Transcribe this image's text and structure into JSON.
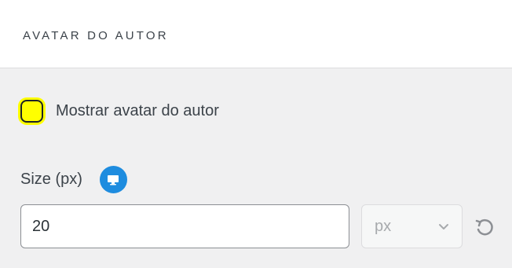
{
  "section": {
    "title": "AVATAR DO AUTOR"
  },
  "checkbox": {
    "label": "Mostrar avatar do autor",
    "checked": false,
    "highlight_color": "#ffff00"
  },
  "size": {
    "label": "Size (px)",
    "device_icon": "desktop-icon",
    "device_icon_color": "#1e8cdf",
    "value": "20",
    "unit": "px",
    "unit_icon": "chevron-down-icon",
    "reset_icon": "reset-icon"
  }
}
